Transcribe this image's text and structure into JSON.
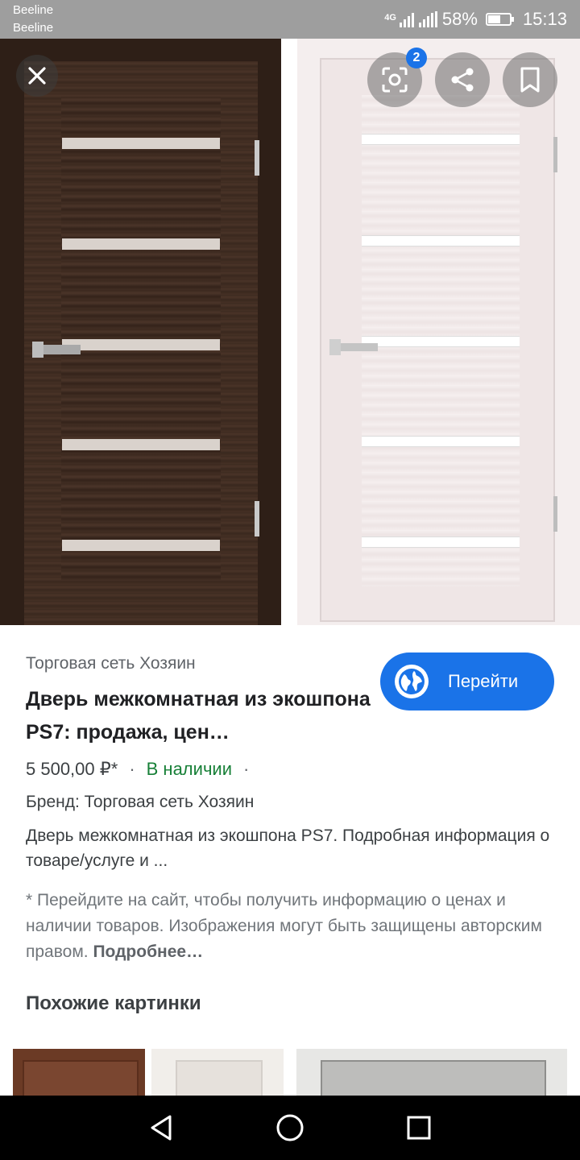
{
  "status_bar": {
    "carrier_1": "Beeline",
    "carrier_2": "Beeline",
    "network_label": "4G",
    "battery_percent": "58%",
    "battery_level": 0.58,
    "time": "15:13"
  },
  "viewer": {
    "lens_badge_count": "2",
    "icons": [
      "close-icon",
      "lens-icon",
      "share-icon",
      "bookmark-icon"
    ]
  },
  "result": {
    "source": "Торговая сеть Хозяин",
    "title": "Дверь межкомнатная из экошпона PS7: продажа, цен…",
    "visit_label": "Перейти",
    "price": "5 500,00 ₽*",
    "separator": "·",
    "availability": "В наличии",
    "brand": "Бренд: Торговая сеть Хозяин",
    "description": "Дверь межкомнатная из экошпона PS7. Подробная информация о товаре/услуге и ...",
    "notice": "* Перейдите на сайт, чтобы получить информацию о ценах и наличии товаров. Изображения могут быть защищены авторским правом.",
    "notice_more": "Подробнее…"
  },
  "similar": {
    "heading": "Похожие картинки"
  },
  "colors": {
    "accent": "#1a73e8",
    "in_stock": "#188038",
    "status_bar": "#9e9e9e"
  }
}
